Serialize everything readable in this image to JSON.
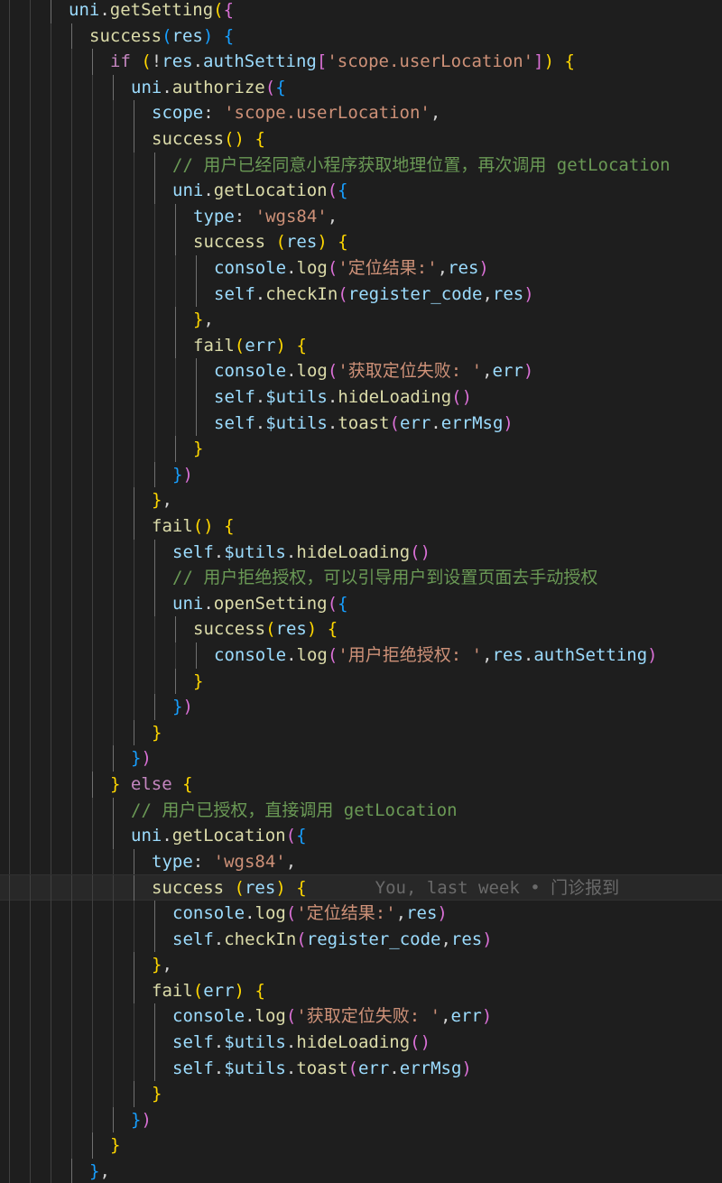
{
  "editor": {
    "blame_annotation": "You, last week • 门诊报到",
    "lines": [
      {
        "indent": 3,
        "tokens": [
          [
            "var",
            "uni"
          ],
          [
            "pn",
            "."
          ],
          [
            "fn",
            "getSetting"
          ],
          [
            "b1",
            "("
          ],
          [
            "b2",
            "{"
          ]
        ]
      },
      {
        "indent": 4,
        "tokens": [
          [
            "fn",
            "success"
          ],
          [
            "b3",
            "("
          ],
          [
            "var",
            "res"
          ],
          [
            "b3",
            ")"
          ],
          [
            "pn",
            " "
          ],
          [
            "b3",
            "{"
          ]
        ]
      },
      {
        "indent": 5,
        "tokens": [
          [
            "ctl",
            "if"
          ],
          [
            "pn",
            " "
          ],
          [
            "b1",
            "("
          ],
          [
            "pn",
            "!"
          ],
          [
            "var",
            "res"
          ],
          [
            "pn",
            "."
          ],
          [
            "var",
            "authSetting"
          ],
          [
            "b2",
            "["
          ],
          [
            "str",
            "'scope.userLocation'"
          ],
          [
            "b2",
            "]"
          ],
          [
            "b1",
            ")"
          ],
          [
            "pn",
            " "
          ],
          [
            "b1",
            "{"
          ]
        ]
      },
      {
        "indent": 6,
        "tokens": [
          [
            "var",
            "uni"
          ],
          [
            "pn",
            "."
          ],
          [
            "fn",
            "authorize"
          ],
          [
            "b2",
            "("
          ],
          [
            "b3",
            "{"
          ]
        ]
      },
      {
        "indent": 7,
        "tokens": [
          [
            "var",
            "scope"
          ],
          [
            "pn",
            ": "
          ],
          [
            "str",
            "'scope.userLocation'"
          ],
          [
            "pn",
            ","
          ]
        ]
      },
      {
        "indent": 7,
        "tokens": [
          [
            "fn",
            "success"
          ],
          [
            "b1",
            "("
          ],
          [
            "b1",
            ")"
          ],
          [
            "pn",
            " "
          ],
          [
            "b1",
            "{"
          ]
        ]
      },
      {
        "indent": 8,
        "tokens": [
          [
            "cm",
            "// 用户已经同意小程序获取地理位置，再次调用 getLocation"
          ]
        ]
      },
      {
        "indent": 8,
        "tokens": [
          [
            "var",
            "uni"
          ],
          [
            "pn",
            "."
          ],
          [
            "fn",
            "getLocation"
          ],
          [
            "b2",
            "("
          ],
          [
            "b3",
            "{"
          ]
        ]
      },
      {
        "indent": 9,
        "tokens": [
          [
            "var",
            "type"
          ],
          [
            "pn",
            ": "
          ],
          [
            "str",
            "'wgs84'"
          ],
          [
            "pn",
            ","
          ]
        ]
      },
      {
        "indent": 9,
        "tokens": [
          [
            "fn",
            "success"
          ],
          [
            "pn",
            " "
          ],
          [
            "b1",
            "("
          ],
          [
            "var",
            "res"
          ],
          [
            "b1",
            ")"
          ],
          [
            "pn",
            " "
          ],
          [
            "b1",
            "{"
          ]
        ]
      },
      {
        "indent": 10,
        "tokens": [
          [
            "var",
            "console"
          ],
          [
            "pn",
            "."
          ],
          [
            "fn",
            "log"
          ],
          [
            "b2",
            "("
          ],
          [
            "str",
            "'定位结果:'"
          ],
          [
            "pn",
            ","
          ],
          [
            "var",
            "res"
          ],
          [
            "b2",
            ")"
          ]
        ]
      },
      {
        "indent": 10,
        "tokens": [
          [
            "var",
            "self"
          ],
          [
            "pn",
            "."
          ],
          [
            "fn",
            "checkIn"
          ],
          [
            "b2",
            "("
          ],
          [
            "var",
            "register_code"
          ],
          [
            "pn",
            ","
          ],
          [
            "var",
            "res"
          ],
          [
            "b2",
            ")"
          ]
        ]
      },
      {
        "indent": 9,
        "tokens": [
          [
            "b1",
            "}"
          ],
          [
            "pn",
            ","
          ]
        ]
      },
      {
        "indent": 9,
        "tokens": [
          [
            "fn",
            "fail"
          ],
          [
            "b1",
            "("
          ],
          [
            "var",
            "err"
          ],
          [
            "b1",
            ")"
          ],
          [
            "pn",
            " "
          ],
          [
            "b1",
            "{"
          ]
        ]
      },
      {
        "indent": 10,
        "tokens": [
          [
            "var",
            "console"
          ],
          [
            "pn",
            "."
          ],
          [
            "fn",
            "log"
          ],
          [
            "b2",
            "("
          ],
          [
            "str",
            "'获取定位失败: '"
          ],
          [
            "pn",
            ","
          ],
          [
            "var",
            "err"
          ],
          [
            "b2",
            ")"
          ]
        ]
      },
      {
        "indent": 10,
        "tokens": [
          [
            "var",
            "self"
          ],
          [
            "pn",
            "."
          ],
          [
            "var",
            "$utils"
          ],
          [
            "pn",
            "."
          ],
          [
            "fn",
            "hideLoading"
          ],
          [
            "b2",
            "("
          ],
          [
            "b2",
            ")"
          ]
        ]
      },
      {
        "indent": 10,
        "tokens": [
          [
            "var",
            "self"
          ],
          [
            "pn",
            "."
          ],
          [
            "var",
            "$utils"
          ],
          [
            "pn",
            "."
          ],
          [
            "fn",
            "toast"
          ],
          [
            "b2",
            "("
          ],
          [
            "var",
            "err"
          ],
          [
            "pn",
            "."
          ],
          [
            "var",
            "errMsg"
          ],
          [
            "b2",
            ")"
          ]
        ]
      },
      {
        "indent": 9,
        "tokens": [
          [
            "b1",
            "}"
          ]
        ]
      },
      {
        "indent": 8,
        "tokens": [
          [
            "b3",
            "}"
          ],
          [
            "b2",
            ")"
          ]
        ]
      },
      {
        "indent": 7,
        "tokens": [
          [
            "b1",
            "}"
          ],
          [
            "pn",
            ","
          ]
        ]
      },
      {
        "indent": 7,
        "tokens": [
          [
            "fn",
            "fail"
          ],
          [
            "b1",
            "("
          ],
          [
            "b1",
            ")"
          ],
          [
            "pn",
            " "
          ],
          [
            "b1",
            "{"
          ]
        ]
      },
      {
        "indent": 8,
        "tokens": [
          [
            "var",
            "self"
          ],
          [
            "pn",
            "."
          ],
          [
            "var",
            "$utils"
          ],
          [
            "pn",
            "."
          ],
          [
            "fn",
            "hideLoading"
          ],
          [
            "b2",
            "("
          ],
          [
            "b2",
            ")"
          ]
        ]
      },
      {
        "indent": 8,
        "tokens": [
          [
            "cm",
            "// 用户拒绝授权，可以引导用户到设置页面去手动授权"
          ]
        ]
      },
      {
        "indent": 8,
        "tokens": [
          [
            "var",
            "uni"
          ],
          [
            "pn",
            "."
          ],
          [
            "fn",
            "openSetting"
          ],
          [
            "b2",
            "("
          ],
          [
            "b3",
            "{"
          ]
        ]
      },
      {
        "indent": 9,
        "tokens": [
          [
            "fn",
            "success"
          ],
          [
            "b1",
            "("
          ],
          [
            "var",
            "res"
          ],
          [
            "b1",
            ")"
          ],
          [
            "pn",
            " "
          ],
          [
            "b1",
            "{"
          ]
        ]
      },
      {
        "indent": 10,
        "tokens": [
          [
            "var",
            "console"
          ],
          [
            "pn",
            "."
          ],
          [
            "fn",
            "log"
          ],
          [
            "b2",
            "("
          ],
          [
            "str",
            "'用户拒绝授权: '"
          ],
          [
            "pn",
            ","
          ],
          [
            "var",
            "res"
          ],
          [
            "pn",
            "."
          ],
          [
            "var",
            "authSetting"
          ],
          [
            "b2",
            ")"
          ]
        ]
      },
      {
        "indent": 9,
        "tokens": [
          [
            "b1",
            "}"
          ]
        ]
      },
      {
        "indent": 8,
        "tokens": [
          [
            "b3",
            "}"
          ],
          [
            "b2",
            ")"
          ]
        ]
      },
      {
        "indent": 7,
        "tokens": [
          [
            "b1",
            "}"
          ]
        ]
      },
      {
        "indent": 6,
        "tokens": [
          [
            "b3",
            "}"
          ],
          [
            "b2",
            ")"
          ]
        ]
      },
      {
        "indent": 5,
        "tokens": [
          [
            "b1",
            "}"
          ],
          [
            "pn",
            " "
          ],
          [
            "ctl",
            "else"
          ],
          [
            "pn",
            " "
          ],
          [
            "b1",
            "{"
          ]
        ]
      },
      {
        "indent": 6,
        "tokens": [
          [
            "cm",
            "// 用户已授权，直接调用 getLocation"
          ]
        ]
      },
      {
        "indent": 6,
        "tokens": [
          [
            "var",
            "uni"
          ],
          [
            "pn",
            "."
          ],
          [
            "fn",
            "getLocation"
          ],
          [
            "b2",
            "("
          ],
          [
            "b3",
            "{"
          ]
        ]
      },
      {
        "indent": 7,
        "tokens": [
          [
            "var",
            "type"
          ],
          [
            "pn",
            ": "
          ],
          [
            "str",
            "'wgs84'"
          ],
          [
            "pn",
            ","
          ]
        ]
      },
      {
        "indent": 7,
        "tokens": [
          [
            "fn",
            "success"
          ],
          [
            "pn",
            " "
          ],
          [
            "b1",
            "("
          ],
          [
            "var",
            "res"
          ],
          [
            "b1",
            ")"
          ],
          [
            "pn",
            " "
          ],
          [
            "b1",
            "{"
          ]
        ],
        "current": true
      },
      {
        "indent": 8,
        "tokens": [
          [
            "var",
            "console"
          ],
          [
            "pn",
            "."
          ],
          [
            "fn",
            "log"
          ],
          [
            "b2",
            "("
          ],
          [
            "str",
            "'定位结果:'"
          ],
          [
            "pn",
            ","
          ],
          [
            "var",
            "res"
          ],
          [
            "b2",
            ")"
          ]
        ]
      },
      {
        "indent": 8,
        "tokens": [
          [
            "var",
            "self"
          ],
          [
            "pn",
            "."
          ],
          [
            "fn",
            "checkIn"
          ],
          [
            "b2",
            "("
          ],
          [
            "var",
            "register_code"
          ],
          [
            "pn",
            ","
          ],
          [
            "var",
            "res"
          ],
          [
            "b2",
            ")"
          ]
        ]
      },
      {
        "indent": 7,
        "tokens": [
          [
            "b1",
            "}"
          ],
          [
            "pn",
            ","
          ]
        ]
      },
      {
        "indent": 7,
        "tokens": [
          [
            "fn",
            "fail"
          ],
          [
            "b1",
            "("
          ],
          [
            "var",
            "err"
          ],
          [
            "b1",
            ")"
          ],
          [
            "pn",
            " "
          ],
          [
            "b1",
            "{"
          ]
        ]
      },
      {
        "indent": 8,
        "tokens": [
          [
            "var",
            "console"
          ],
          [
            "pn",
            "."
          ],
          [
            "fn",
            "log"
          ],
          [
            "b2",
            "("
          ],
          [
            "str",
            "'获取定位失败: '"
          ],
          [
            "pn",
            ","
          ],
          [
            "var",
            "err"
          ],
          [
            "b2",
            ")"
          ]
        ]
      },
      {
        "indent": 8,
        "tokens": [
          [
            "var",
            "self"
          ],
          [
            "pn",
            "."
          ],
          [
            "var",
            "$utils"
          ],
          [
            "pn",
            "."
          ],
          [
            "fn",
            "hideLoading"
          ],
          [
            "b2",
            "("
          ],
          [
            "b2",
            ")"
          ]
        ]
      },
      {
        "indent": 8,
        "tokens": [
          [
            "var",
            "self"
          ],
          [
            "pn",
            "."
          ],
          [
            "var",
            "$utils"
          ],
          [
            "pn",
            "."
          ],
          [
            "fn",
            "toast"
          ],
          [
            "b2",
            "("
          ],
          [
            "var",
            "err"
          ],
          [
            "pn",
            "."
          ],
          [
            "var",
            "errMsg"
          ],
          [
            "b2",
            ")"
          ]
        ]
      },
      {
        "indent": 7,
        "tokens": [
          [
            "b1",
            "}"
          ]
        ]
      },
      {
        "indent": 6,
        "tokens": [
          [
            "b3",
            "}"
          ],
          [
            "b2",
            ")"
          ]
        ]
      },
      {
        "indent": 5,
        "tokens": [
          [
            "b1",
            "}"
          ]
        ]
      },
      {
        "indent": 4,
        "tokens": [
          [
            "b3",
            "}"
          ],
          [
            "pn",
            ","
          ]
        ]
      }
    ]
  }
}
